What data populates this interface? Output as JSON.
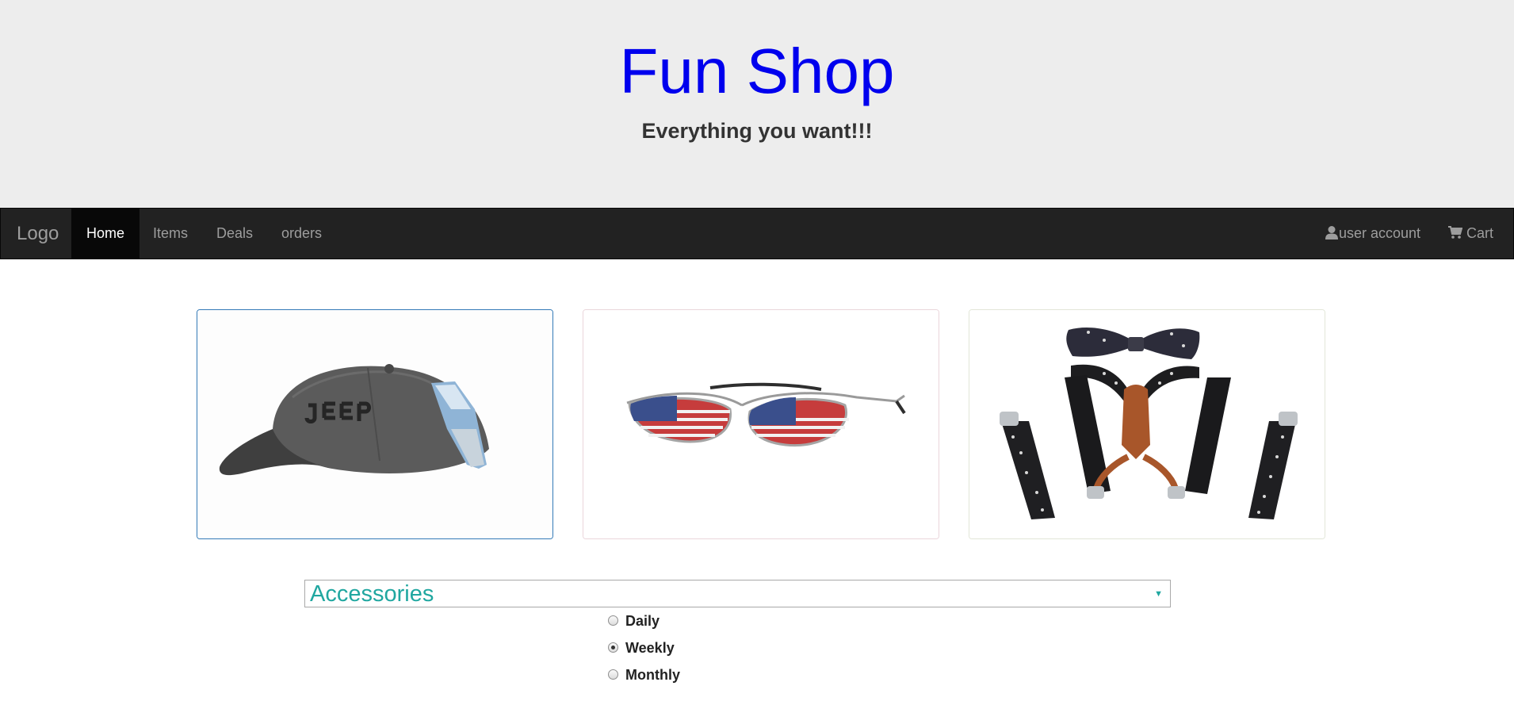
{
  "header": {
    "title": "Fun Shop",
    "tagline": "Everything you want!!!",
    "title_color": "#0000ee",
    "background": "#ededed"
  },
  "navbar": {
    "brand": "Logo",
    "items": [
      {
        "label": "Home",
        "active": true
      },
      {
        "label": "Items",
        "active": false
      },
      {
        "label": "Deals",
        "active": false
      },
      {
        "label": "orders",
        "active": false
      }
    ],
    "right": [
      {
        "label": "user account",
        "icon": "user-icon"
      },
      {
        "label": "Cart",
        "icon": "cart-icon"
      }
    ]
  },
  "products": [
    {
      "name": "cap",
      "icon": "baseball-cap-image",
      "selected": true
    },
    {
      "name": "sunglasses",
      "icon": "flag-aviator-sunglasses-image",
      "selected": false
    },
    {
      "name": "suspenders",
      "icon": "bowtie-suspenders-image",
      "selected": false
    }
  ],
  "category_select": {
    "value": "Accessories",
    "text_color": "#20a7a0"
  },
  "frequency": {
    "options": [
      {
        "label": "Daily",
        "checked": false
      },
      {
        "label": "Weekly",
        "checked": true
      },
      {
        "label": "Monthly",
        "checked": false
      }
    ]
  }
}
